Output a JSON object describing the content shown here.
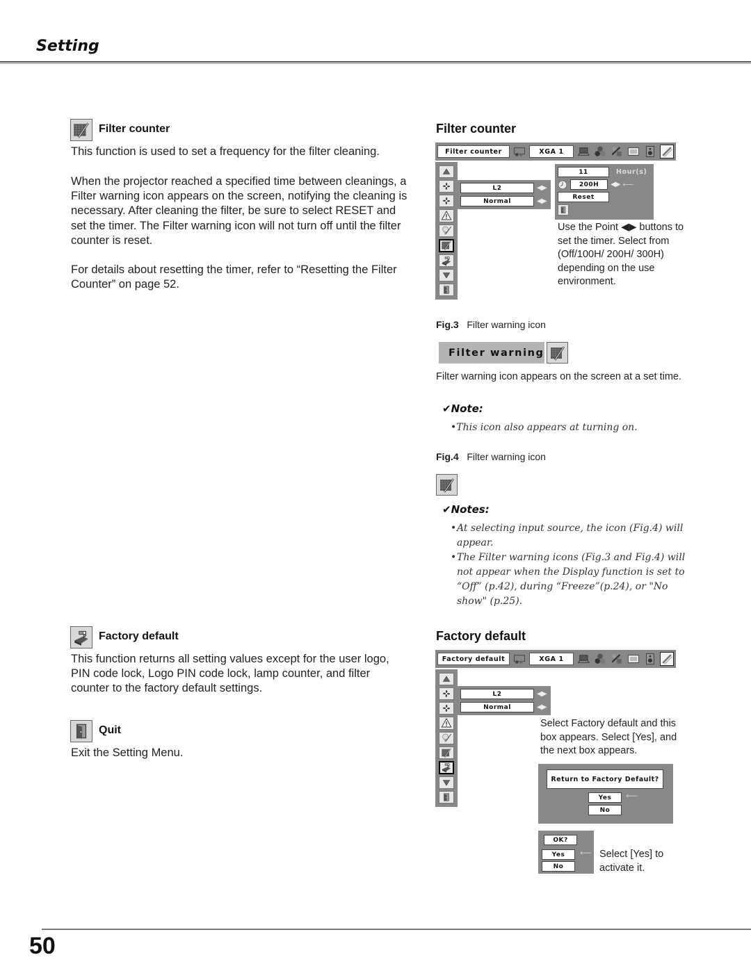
{
  "header": {
    "title": "Setting"
  },
  "left": {
    "filter_counter": {
      "heading": "Filter counter",
      "icon": "filter-counter-icon",
      "para1": "This function is used to set a frequency for the filter cleaning.",
      "para2": "When the projector reached a specified time between cleanings, a Filter warning icon appears on the screen, notifying the cleaning is necessary. After cleaning the filter, be sure to select RESET and set the timer. The Filter warning icon will not turn off until the filter counter is reset.",
      "para3": "For details about resetting the timer, refer to “Resetting the Filter Counter” on page 52."
    },
    "factory_default": {
      "heading": "Factory default",
      "icon": "factory-default-icon",
      "para1": "This function returns all setting values except for the user logo, PIN code lock, Logo PIN code lock, lamp counter, and filter counter to the factory default settings."
    },
    "quit": {
      "heading": "Quit",
      "icon": "quit-door-icon",
      "para1": "Exit the Setting Menu."
    }
  },
  "right": {
    "filter_counter": {
      "heading": "Filter counter",
      "osd": {
        "menu_label": "Filter counter",
        "source": "XGA 1",
        "sub_values": [
          "L2",
          "Normal"
        ],
        "hours_value": "11",
        "hours_unit": "Hour(s)",
        "timer_value": "200H",
        "reset_label": "Reset"
      },
      "caption": "Use the Point ◀▶ buttons to set the timer. Select from (Off/100H/ 200H/ 300H) depending on the use environment."
    },
    "fig3": {
      "label": "Fig.3",
      "text": "Filter warning icon",
      "badge": "Filter warning",
      "caption": "Filter warning icon appears on the screen at a set time.",
      "note_head": "Note:",
      "notes": [
        "This icon also appears at turning on."
      ]
    },
    "fig4": {
      "label": "Fig.4",
      "text": "Filter warning icon",
      "note_head": "Notes:",
      "notes": [
        "At selecting input source, the icon (Fig.4) will appear.",
        "The Filter warning icons (Fig.3 and Fig.4) will not appear when the Display function is set to “Off” (p.42), during “Freeze”(p.24), or \"No show\" (p.25)."
      ]
    },
    "factory_default": {
      "heading": "Factory default",
      "osd": {
        "menu_label": "Factory default",
        "source": "XGA 1",
        "sub_values": [
          "L2",
          "Normal"
        ]
      },
      "caption1": "Select Factory default and this box appears. Select [Yes], and the next box appears.",
      "dialog1": {
        "question": "Return to Factory Default?",
        "yes": "Yes",
        "no": "No"
      },
      "dialog2": {
        "question": "OK?",
        "yes": "Yes",
        "no": "No"
      },
      "caption2": "Select [Yes] to activate it."
    }
  },
  "footer": {
    "page_number": "50"
  }
}
